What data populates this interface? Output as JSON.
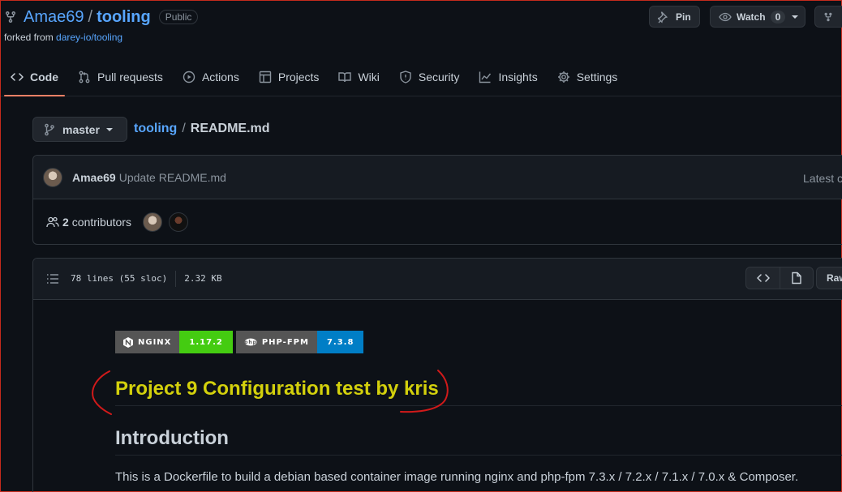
{
  "repo": {
    "owner": "Amae69",
    "separator": "/",
    "name": "tooling",
    "visibility": "Public",
    "forked_prefix": "forked from",
    "forked_from": "darey-io/tooling"
  },
  "header_actions": {
    "pin_label": "Pin",
    "watch_label": "Watch",
    "watch_count": "0"
  },
  "tabs": [
    {
      "label": "Code",
      "icon": "code-icon",
      "active": true
    },
    {
      "label": "Pull requests",
      "icon": "pull-request-icon"
    },
    {
      "label": "Actions",
      "icon": "play-icon"
    },
    {
      "label": "Projects",
      "icon": "table-icon"
    },
    {
      "label": "Wiki",
      "icon": "book-icon"
    },
    {
      "label": "Security",
      "icon": "shield-icon"
    },
    {
      "label": "Insights",
      "icon": "graph-icon"
    },
    {
      "label": "Settings",
      "icon": "gear-icon"
    }
  ],
  "branch": {
    "name": "master"
  },
  "breadcrumb": {
    "repo": "tooling",
    "separator": "/",
    "file": "README.md"
  },
  "commit": {
    "author": "Amae69",
    "message": "Update README.md",
    "latest": "Latest c"
  },
  "contributors": {
    "count": "2",
    "label": "contributors"
  },
  "file": {
    "lines": "78 lines (55 sloc)",
    "size": "2.32 KB",
    "raw_label": "Raw"
  },
  "readme": {
    "shields": [
      {
        "name": "NGINX",
        "version": "1.17.2",
        "color": "#44cc11"
      },
      {
        "name": "PHP-FPM",
        "version": "7.3.8",
        "color": "#007ec6"
      }
    ],
    "heading_project": "Project 9 Configuration test by kris",
    "heading_intro": "Introduction",
    "paragraph": "This is a Dockerfile to build a debian based container image running nginx and php-fpm 7.3.x / 7.2.x / 7.1.x / 7.0.x & Composer."
  },
  "colors": {
    "background": "#0d1117",
    "accent": "#58a6ff",
    "tab_underline": "#f78166",
    "annotation": "#d11a1a",
    "project_heading": "#d3d00c"
  }
}
